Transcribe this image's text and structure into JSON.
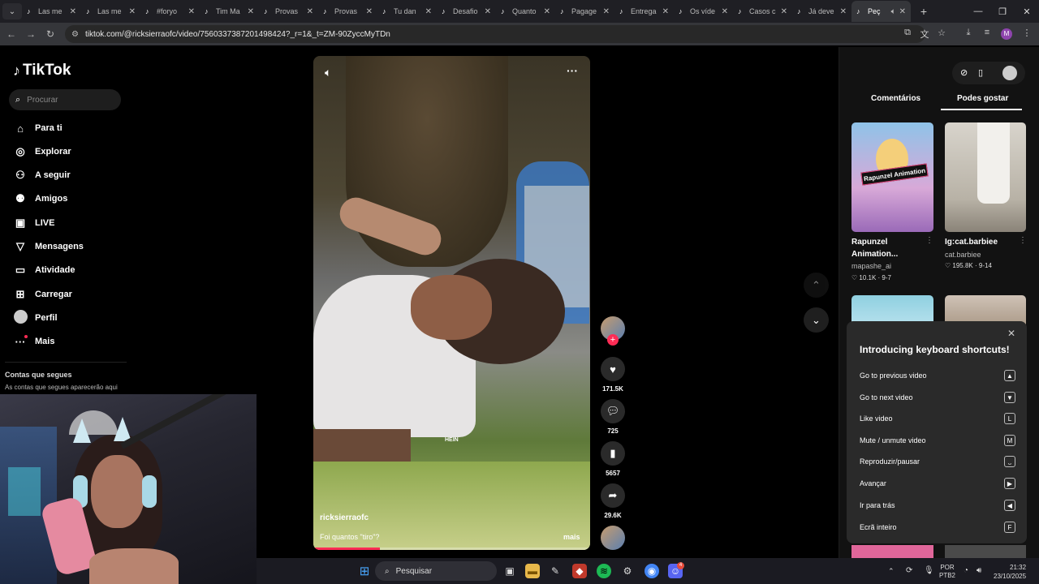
{
  "browser": {
    "tabs": [
      {
        "label": "Las me",
        "favicon": "tiktok-icon"
      },
      {
        "label": "Las me",
        "favicon": "tiktok-icon"
      },
      {
        "label": "#foryo",
        "favicon": "tiktok-icon"
      },
      {
        "label": "Tim Ma",
        "favicon": "tiktok-icon"
      },
      {
        "label": "Provas",
        "favicon": "tiktok-icon"
      },
      {
        "label": "Provas",
        "favicon": "tiktok-icon"
      },
      {
        "label": "Tu dan",
        "favicon": "tiktok-icon"
      },
      {
        "label": "Desafio",
        "favicon": "tiktok-icon"
      },
      {
        "label": "Quanto",
        "favicon": "tiktok-icon"
      },
      {
        "label": "Pagage",
        "favicon": "tiktok-icon"
      },
      {
        "label": "Entrega",
        "favicon": "tiktok-icon"
      },
      {
        "label": "Os víde",
        "favicon": "tiktok-icon"
      },
      {
        "label": "Casos c",
        "favicon": "tiktok-icon"
      },
      {
        "label": "Já deve",
        "favicon": "tiktok-icon"
      },
      {
        "label": "Peç",
        "favicon": "tiktok-icon"
      }
    ],
    "url": "tiktok.com/@ricksierraofc/video/7560337387201498424?_r=1&_t=ZM-90ZyccMyTDn",
    "profile_initial": "M"
  },
  "sidebar": {
    "logo": "TikTok",
    "search_placeholder": "Procurar",
    "items": [
      {
        "label": "Para ti",
        "icon": "home-icon"
      },
      {
        "label": "Explorar",
        "icon": "compass-icon"
      },
      {
        "label": "A seguir",
        "icon": "following-icon"
      },
      {
        "label": "Amigos",
        "icon": "friends-icon"
      },
      {
        "label": "LIVE",
        "icon": "live-icon"
      },
      {
        "label": "Mensagens",
        "icon": "send-icon"
      },
      {
        "label": "Atividade",
        "icon": "inbox-icon"
      },
      {
        "label": "Carregar",
        "icon": "upload-icon"
      },
      {
        "label": "Perfil",
        "icon": "avatar"
      },
      {
        "label": "Mais",
        "icon": "more-icon"
      }
    ],
    "following_heading": "Contas que segues",
    "following_sub": "As contas que segues aparecerão aqui"
  },
  "video": {
    "author": "ricksierraofc",
    "caption": "Foi quantos \"tiro\"?",
    "more": "mais",
    "overlay_text": "HEIN",
    "progress": 0.24
  },
  "actions": {
    "likes": "171.5K",
    "comments": "725",
    "saves": "5657",
    "shares": "29.6K"
  },
  "right_panel": {
    "tab_comments": "Comentários",
    "tab_suggested": "Podes gostar",
    "cards": [
      {
        "title_line1": "Rapunzel",
        "title_line2": "Animation...",
        "user": "mapashe_ai",
        "likes": "10.1K",
        "date": "9-7",
        "thumb_label": "Rapunzel Animation"
      },
      {
        "title_line1": "Ig:cat.barbiee",
        "title_line2": "",
        "user": "cat.barbiee",
        "likes": "195.8K",
        "date": "9-14",
        "thumb_label": ""
      }
    ]
  },
  "shortcuts": {
    "title": "Introducing keyboard shortcuts!",
    "items": [
      {
        "label": "Go to previous video",
        "key": "▲"
      },
      {
        "label": "Go to next video",
        "key": "▼"
      },
      {
        "label": "Like video",
        "key": "L"
      },
      {
        "label": "Mute / unmute video",
        "key": "M"
      },
      {
        "label": "Reproduzir/pausar",
        "key": "⎵"
      },
      {
        "label": "Avançar",
        "key": "▶"
      },
      {
        "label": "Ir para trás",
        "key": "◀"
      },
      {
        "label": "Ecrã inteiro",
        "key": "F"
      }
    ]
  },
  "taskbar": {
    "search": "Pesquisar",
    "lang1": "POR",
    "lang2": "PTB2",
    "time": "21:32",
    "date": "23/10/2025",
    "discord_badge": "4"
  },
  "colors": {
    "accent": "#fe2c55",
    "bg": "#000000",
    "panel": "#121212"
  }
}
